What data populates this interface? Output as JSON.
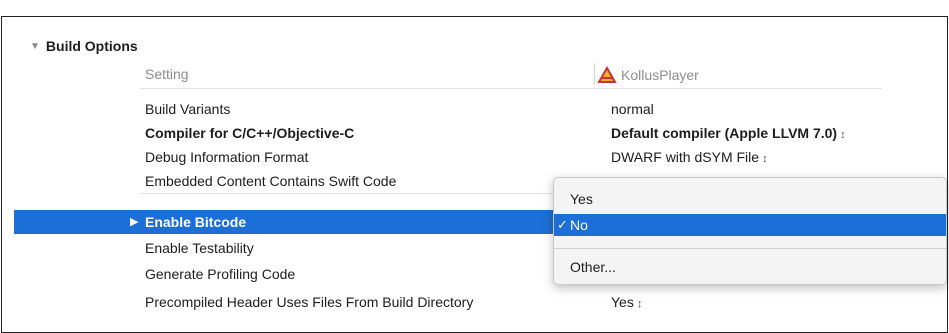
{
  "section": {
    "title": "Build Options"
  },
  "header": {
    "setting_label": "Setting",
    "target_name": "KollusPlayer",
    "target_icon": "app-target-icon"
  },
  "rows": [
    {
      "name": "Build Variants",
      "value": "normal",
      "stepper": ""
    },
    {
      "name": "Compiler for C/C++/Objective-C",
      "value": "Default compiler (Apple LLVM 7.0)",
      "stepper": "↕"
    },
    {
      "name": "Debug Information Format",
      "value": "DWARF with dSYM File",
      "stepper": "↕"
    },
    {
      "name": "Embedded Content Contains Swift Code",
      "value": "",
      "stepper": ""
    },
    {
      "name": "Enable Bitcode",
      "value": "",
      "stepper": ""
    },
    {
      "name": "Enable Testability",
      "value": "",
      "stepper": ""
    },
    {
      "name": "Generate Profiling Code",
      "value": "",
      "stepper": ""
    },
    {
      "name": "Precompiled Header Uses Files From Build Directory",
      "value": "Yes",
      "stepper": "↕"
    }
  ],
  "popup": {
    "options": [
      "Yes",
      "No",
      "Other..."
    ],
    "selected": "No",
    "check_glyph": "✓"
  },
  "colors": {
    "selection": "#1b6fd6"
  }
}
